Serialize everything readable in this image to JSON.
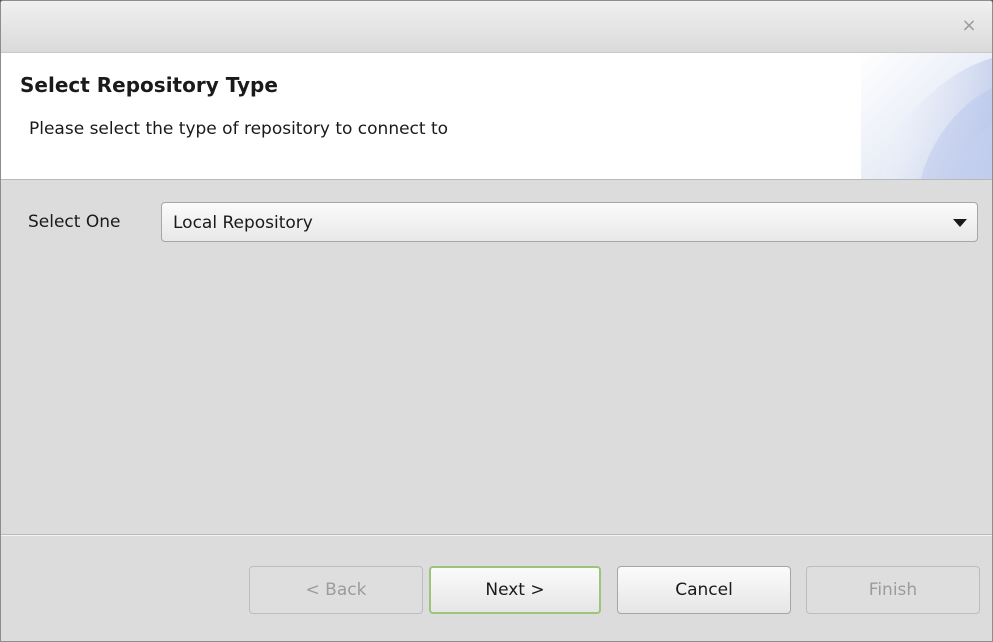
{
  "window": {
    "close_glyph": "×"
  },
  "header": {
    "title": "Select Repository Type",
    "description": "Please select the type of repository to connect to"
  },
  "form": {
    "select_label": "Select One",
    "select_value": "Local Repository"
  },
  "buttons": {
    "back": {
      "label": "< Back",
      "enabled": false
    },
    "next": {
      "label": "Next >",
      "enabled": true,
      "default": true
    },
    "cancel": {
      "label": "Cancel",
      "enabled": true
    },
    "finish": {
      "label": "Finish",
      "enabled": false
    }
  },
  "colors": {
    "dialog_background": "#dcdcdc",
    "header_background": "#ffffff",
    "default_button_border": "#9cc47c",
    "disabled_text": "#9c9c9c"
  }
}
